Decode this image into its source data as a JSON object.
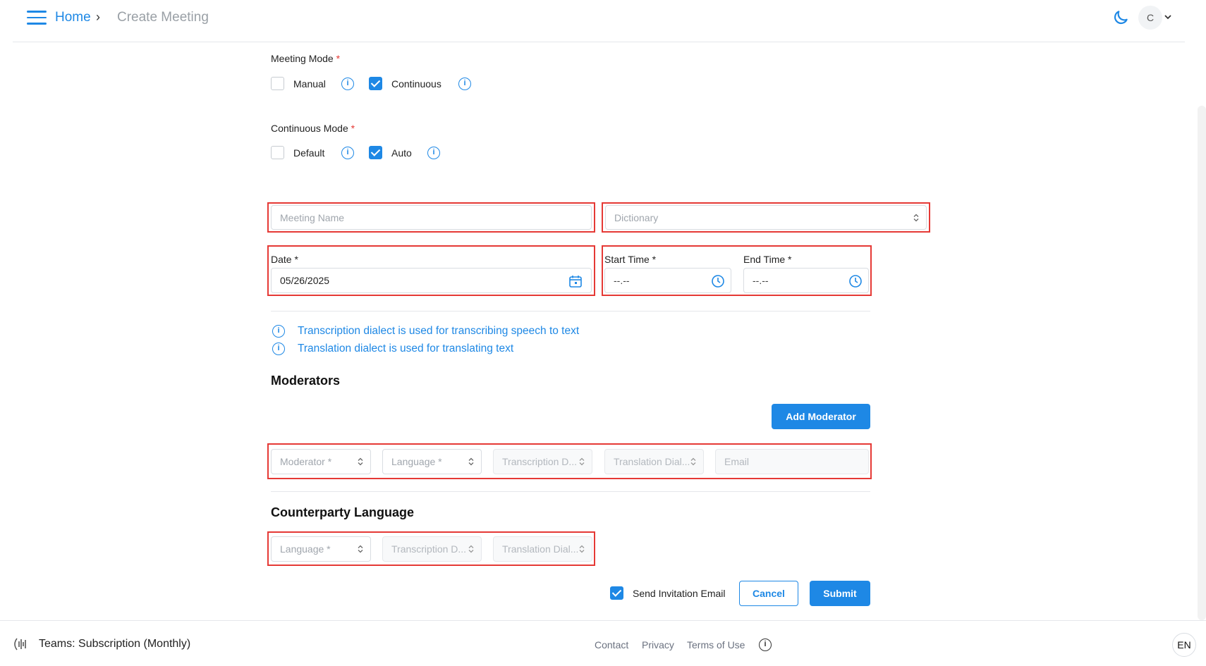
{
  "header": {
    "home": "Home",
    "separator": "›",
    "current": "Create Meeting",
    "avatar_initial": "C"
  },
  "meeting_mode": {
    "label": "Meeting Mode",
    "required": "*",
    "options": [
      {
        "label": "Manual",
        "checked": false
      },
      {
        "label": "Continuous",
        "checked": true
      }
    ]
  },
  "continuous_mode": {
    "label": "Continuous Mode",
    "required": "*",
    "options": [
      {
        "label": "Default",
        "checked": false
      },
      {
        "label": "Auto",
        "checked": true
      }
    ]
  },
  "fields": {
    "meeting_name_placeholder": "Meeting Name",
    "dictionary_placeholder": "Dictionary",
    "date_label": "Date *",
    "date_value": "05/26/2025",
    "start_time_label": "Start Time *",
    "start_time_value": "--.--",
    "end_time_label": "End Time *",
    "end_time_value": "--.--"
  },
  "notes": [
    "Transcription dialect is used for transcribing speech to text",
    "Translation dialect is used for translating text"
  ],
  "moderators": {
    "title": "Moderators",
    "add_button": "Add Moderator",
    "row": {
      "moderator": "Moderator *",
      "language": "Language *",
      "transcription": "Transcription D...",
      "translation": "Translation Dial...",
      "email": "Email"
    }
  },
  "counterparty": {
    "title": "Counterparty Language",
    "row": {
      "language": "Language *",
      "transcription": "Transcription D...",
      "translation": "Translation Dial..."
    }
  },
  "actions": {
    "send_invitation": "Send Invitation Email",
    "send_invitation_checked": true,
    "cancel": "Cancel",
    "submit": "Submit"
  },
  "footer": {
    "subscription": "Teams: Subscription (Monthly)",
    "contact": "Contact",
    "privacy": "Privacy",
    "terms": "Terms of Use",
    "language": "EN"
  },
  "colors": {
    "accent": "#1e88e5",
    "highlight": "#e53935"
  }
}
